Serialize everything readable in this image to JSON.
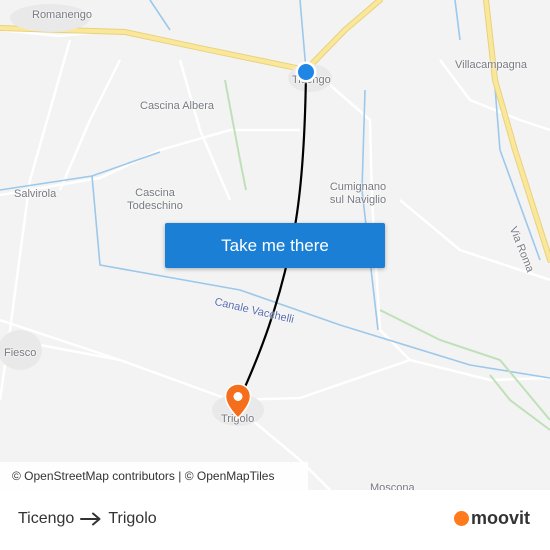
{
  "map": {
    "places": {
      "romanengo": "Romanengo",
      "ticengo": "Ticengo",
      "villacampagna": "Villacampagna",
      "cascina_albera": "Cascina Albera",
      "salvirola": "Salvirola",
      "cascina_todeschino": "Cascina\nTodeschino",
      "cumignano": "Cumignano\nsul Naviglio",
      "fiesco": "Fiesco",
      "trigolo": "Trigolo",
      "moscona": "Moscona"
    },
    "roads": {
      "via_roma": "Via Roma"
    },
    "waterways": {
      "canale_vacchelli": "Canale Vacchelli"
    },
    "colors": {
      "background": "#f3f3f4",
      "main_road": "#fbe79a",
      "water": "#9cc8ea",
      "route_line": "#000000",
      "origin_marker": "#1f86e6",
      "destination_marker": "#f56e1c"
    }
  },
  "cta": {
    "label": "Take me there"
  },
  "attribution": {
    "text": "© OpenStreetMap contributors | © OpenMapTiles"
  },
  "footer": {
    "origin": "Ticengo",
    "destination": "Trigolo",
    "brand": "moovit"
  }
}
